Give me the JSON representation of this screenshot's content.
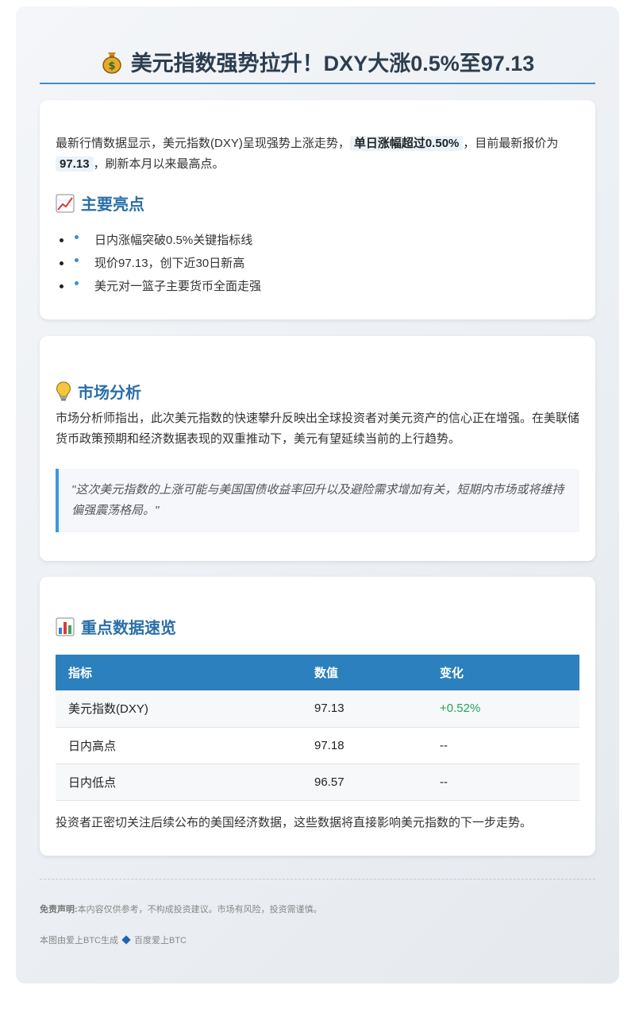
{
  "header": {
    "title": "美元指数强势拉升！DXY大涨0.5%至97.13"
  },
  "intro": {
    "text_before": "最新行情数据显示，美元指数(DXY)呈现强势上涨走势，",
    "highlight1": "单日涨幅超过0.50%",
    "text_middle": "，目前最新报价为",
    "highlight2": "97.13",
    "text_after": "，刷新本月以来最高点。"
  },
  "highlights": {
    "title": "主要亮点",
    "items": [
      "日内涨幅突破0.5%关键指标线",
      "现价97.13，创下近30日新高",
      "美元对一篮子主要货币全面走强"
    ]
  },
  "analysis": {
    "title": "市场分析",
    "text": "市场分析师指出，此次美元指数的快速攀升反映出全球投资者对美元资产的信心正在增强。在美联储货币政策预期和经济数据表现的双重推动下，美元有望延续当前的上行趋势。",
    "quote": "\"这次美元指数的上涨可能与美国国债收益率回升以及避险需求增加有关，短期内市场或将维持偏强震荡格局。\""
  },
  "data_section": {
    "title": "重点数据速览",
    "headers": [
      "指标",
      "数值",
      "变化"
    ],
    "rows": [
      [
        "美元指数(DXY)",
        "97.13",
        "+0.52%"
      ],
      [
        "日内高点",
        "97.18",
        "--"
      ],
      [
        "日内低点",
        "96.57",
        "--"
      ]
    ],
    "note": "投资者正密切关注后续公布的美国经济数据，这些数据将直接影响美元指数的下一步走势。"
  },
  "footer": {
    "disclaimer_label": "免责声明:",
    "disclaimer_text": "本内容仅供参考，不构成投资建议。市场有风险，投资需谨慎。",
    "credit_left": "本图由爱上BTC生成",
    "credit_right": "百度爱上BTC"
  },
  "colors": {
    "accent": "#2b80bd",
    "positive": "#27a55a",
    "section_title": "#2a6fa8"
  }
}
